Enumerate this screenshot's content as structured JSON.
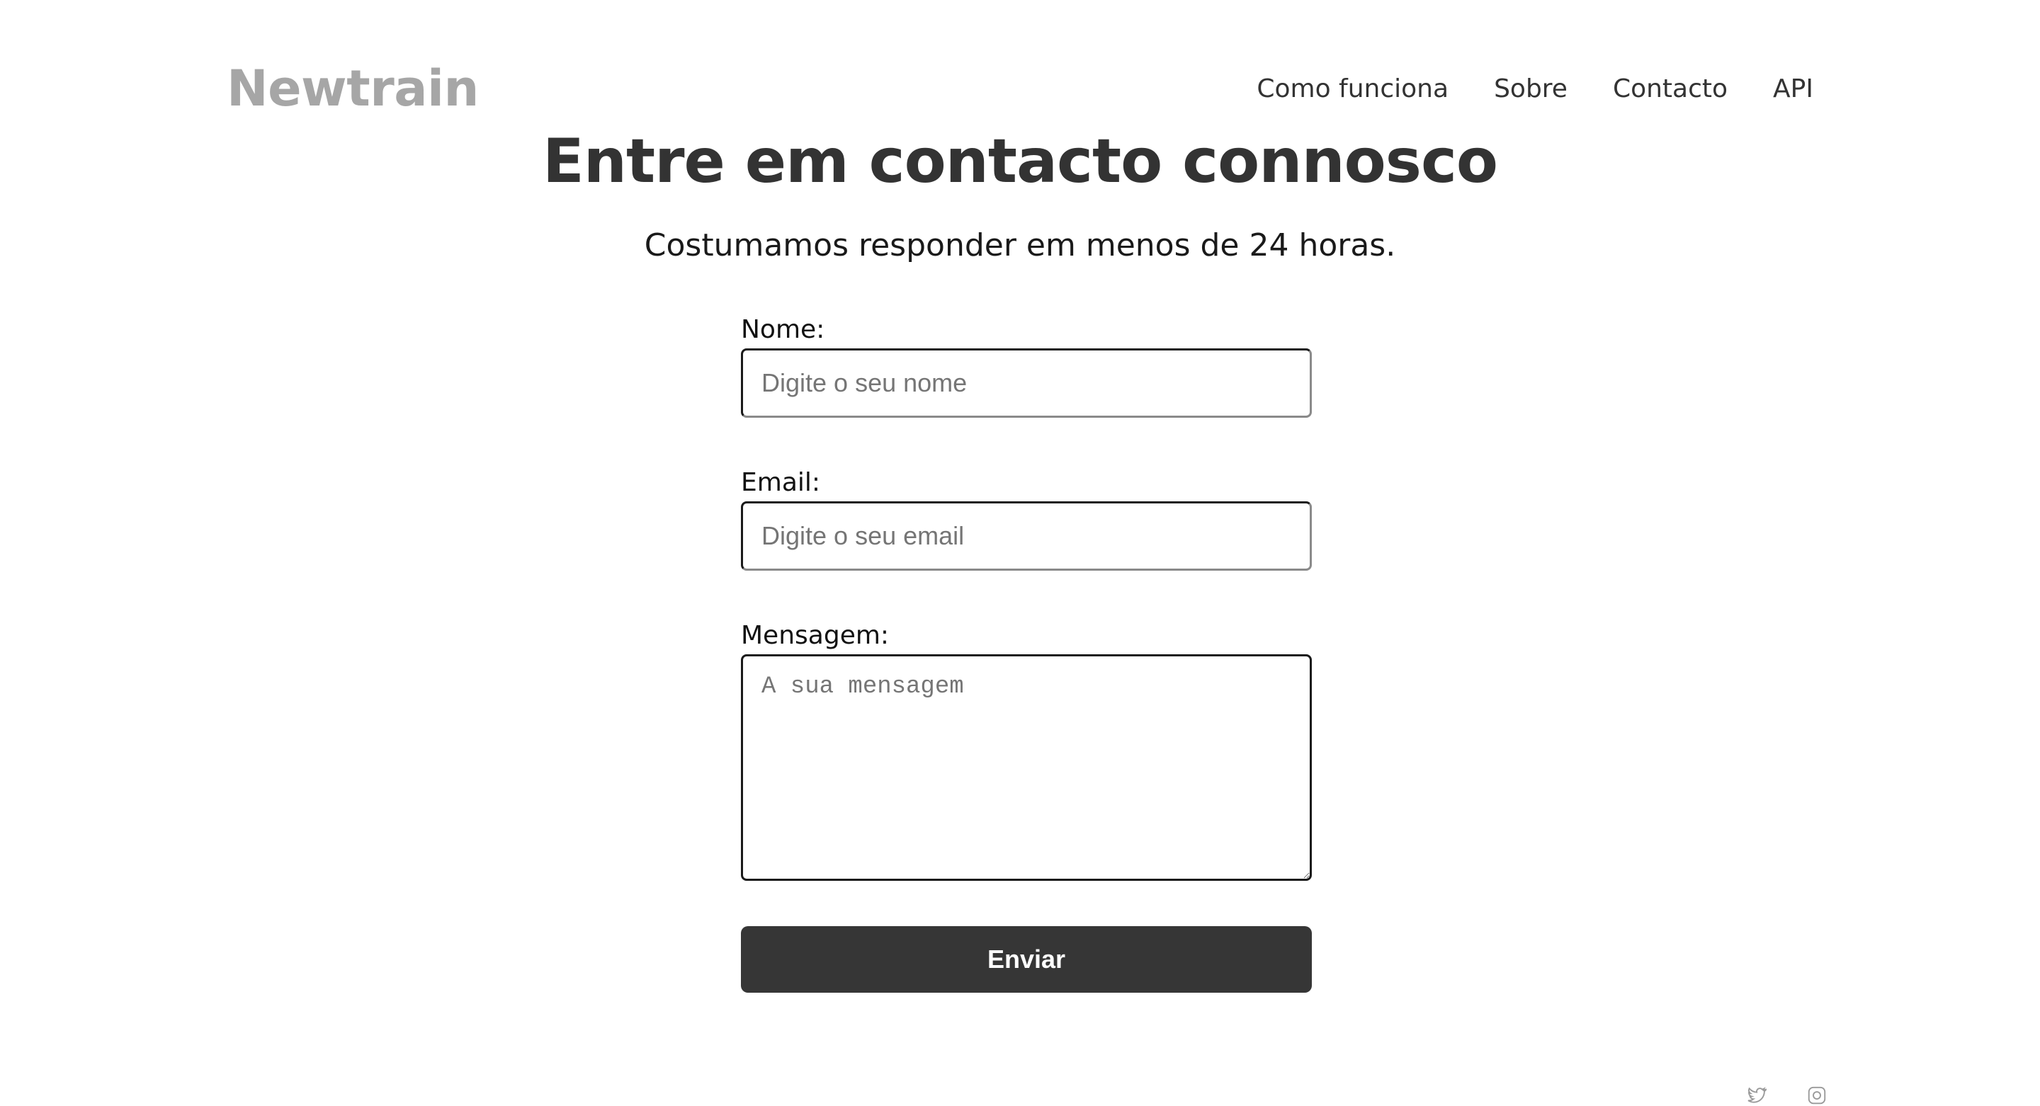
{
  "header": {
    "logo": "Newtrain",
    "nav": [
      {
        "label": "Como funciona"
      },
      {
        "label": "Sobre"
      },
      {
        "label": "Contacto"
      },
      {
        "label": "API"
      }
    ]
  },
  "main": {
    "title": "Entre em contacto connosco",
    "subtitle": "Costumamos responder em menos de 24 horas.",
    "form": {
      "name": {
        "label": "Nome:",
        "placeholder": "Digite o seu nome",
        "value": ""
      },
      "email": {
        "label": "Email:",
        "placeholder": "Digite o seu email",
        "value": ""
      },
      "message": {
        "label": "Mensagem:",
        "placeholder": "A sua mensagem",
        "value": ""
      },
      "submit_label": "Enviar"
    }
  },
  "footer": {
    "icons": [
      "twitter-icon",
      "instagram-icon"
    ]
  },
  "colors": {
    "logo": "#a6a6a6",
    "text": "#333333",
    "button_bg": "#363636",
    "button_text": "#ffffff"
  }
}
